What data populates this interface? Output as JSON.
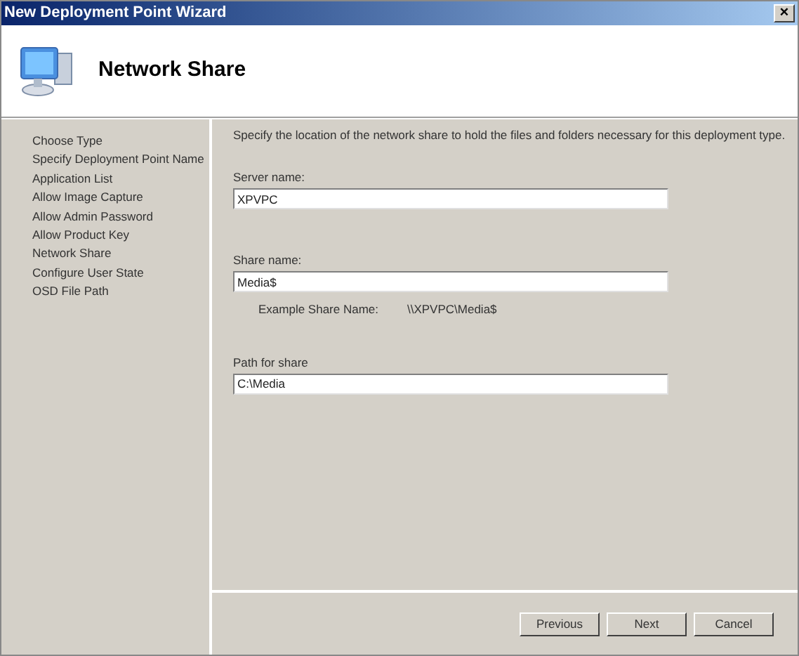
{
  "window": {
    "title": "New Deployment Point Wizard",
    "close": "×"
  },
  "header": {
    "title": "Network Share"
  },
  "steps": [
    "Choose Type",
    "Specify Deployment Point Name",
    "Application List",
    "Allow Image Capture",
    "Allow Admin Password",
    "Allow Product Key",
    "Network Share",
    "Configure User State",
    "OSD File Path"
  ],
  "description": "Specify the location of the network share to hold the files and folders necessary for this deployment type.",
  "fields": [
    {
      "label": "Server name:",
      "value": "XPVPC"
    },
    {
      "label": "Share name:",
      "value": "Media$",
      "example_label": "Example Share Name:",
      "example_value": "\\\\XPVPC\\Media$"
    },
    {
      "label": "Path for share",
      "value": "C:\\Media"
    }
  ],
  "buttons": [
    "Previous",
    "Next",
    "Cancel"
  ]
}
